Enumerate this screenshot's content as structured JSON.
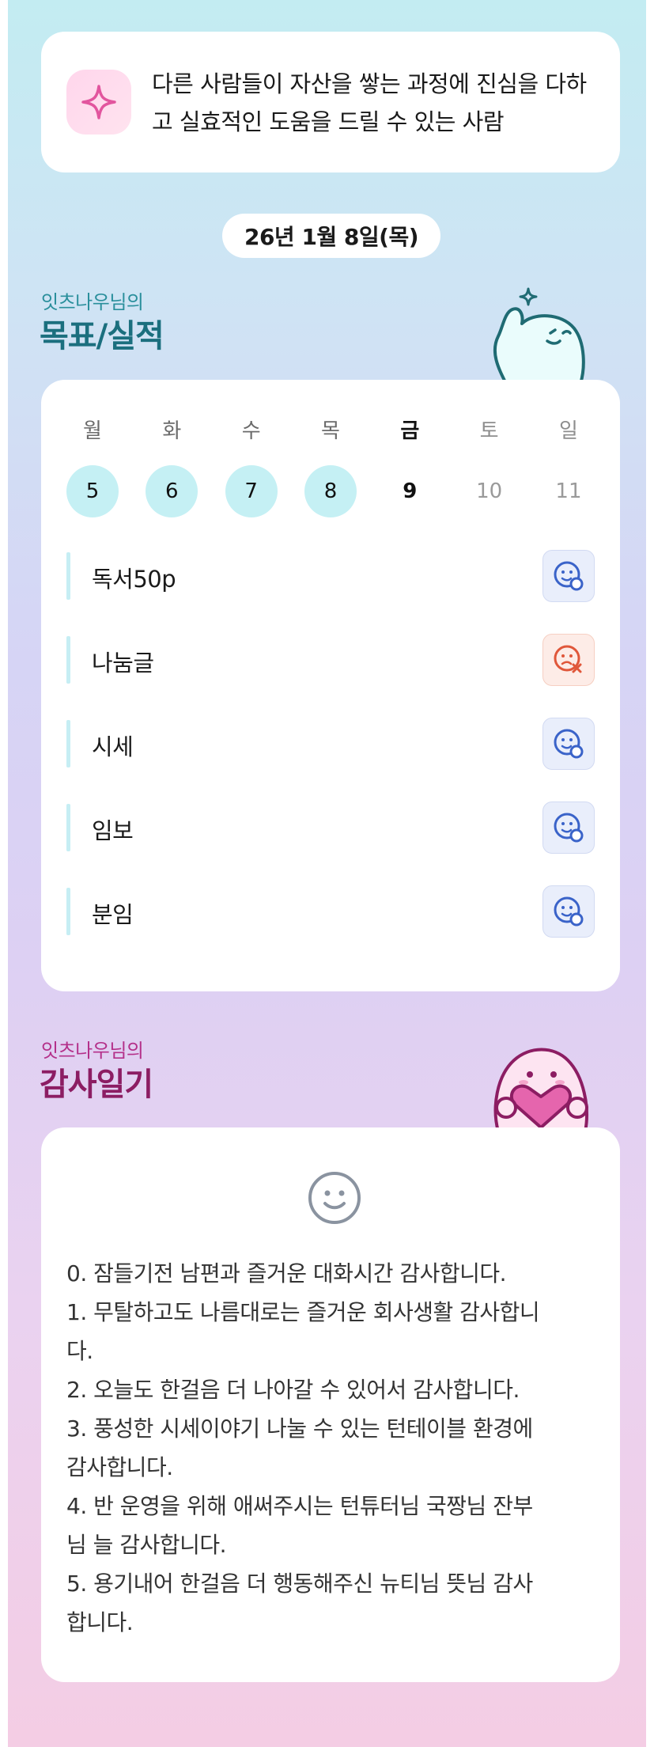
{
  "mission": {
    "icon": "sparkle-icon",
    "text": "다른 사람들이 자산을 쌓는 과정에 진심을 다하고 실효적인 도움을 드릴 수 있는 사람"
  },
  "date_label": "26년 1월 8일(목)",
  "goals_section": {
    "subtitle": "잇츠나우님의",
    "title": "목표/실적"
  },
  "week": {
    "days": [
      {
        "label": "월",
        "date": "5",
        "state": "done"
      },
      {
        "label": "화",
        "date": "6",
        "state": "done"
      },
      {
        "label": "수",
        "date": "7",
        "state": "done"
      },
      {
        "label": "목",
        "date": "8",
        "state": "done"
      },
      {
        "label": "금",
        "date": "9",
        "state": "today"
      },
      {
        "label": "토",
        "date": "10",
        "state": "future"
      },
      {
        "label": "일",
        "date": "11",
        "state": "future"
      }
    ]
  },
  "goals": [
    {
      "name": "독서50p",
      "status": "achieved",
      "status_icon": "smile-check-icon"
    },
    {
      "name": "나눔글",
      "status": "missed",
      "status_icon": "sad-x-icon"
    },
    {
      "name": "시세",
      "status": "achieved",
      "status_icon": "smile-check-icon"
    },
    {
      "name": "임보",
      "status": "achieved",
      "status_icon": "smile-check-icon"
    },
    {
      "name": "분임",
      "status": "achieved",
      "status_icon": "smile-check-icon"
    }
  ],
  "thanks_section": {
    "subtitle": "잇츠나우님의",
    "title": "감사일기",
    "mood_icon": "smile-face-icon",
    "entries": [
      "0. 잠들기전 남편과 즐거운 대화시간 감사합니다.",
      "1. 무탈하고도 나름대로는 즐거운 회사생활 감사합니",
      "다.",
      "2. 오늘도 한걸음 더 나아갈 수 있어서 감사합니다.",
      "3. 풍성한 시세이야기  나눌 수 있는 턴테이블 환경에",
      "감사합니다.",
      "4. 반 운영을 위해 애써주시는 턴튜터님 국짱님 잔부",
      "님 늘 감사합니다.",
      "5. 용기내어 한걸음 더 행동해주신 뉴티님 뜻님 감사",
      "합니다."
    ]
  },
  "colors": {
    "accent_teal": "#1b6f7e",
    "accent_magenta": "#8c1d63",
    "done_circle": "#c5f0f4",
    "achieved_icon": "#3a63c9",
    "missed_icon": "#e0573a"
  }
}
